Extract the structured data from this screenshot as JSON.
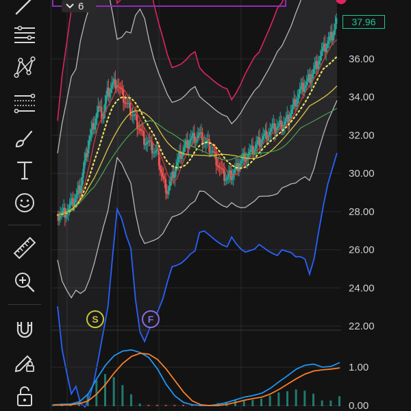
{
  "toolbar": {
    "tools": [
      {
        "name": "trend-line-tool-icon"
      },
      {
        "name": "horizontal-lines-tool-icon"
      },
      {
        "name": "pattern-tool-icon"
      },
      {
        "name": "fib-tool-icon"
      },
      {
        "name": "brush-tool-icon"
      },
      {
        "name": "text-tool-icon"
      },
      {
        "name": "emoji-tool-icon"
      },
      {
        "name": "ruler-tool-icon"
      },
      {
        "name": "zoom-in-tool-icon"
      },
      {
        "name": "magnet-tool-icon"
      },
      {
        "name": "lock-drawings-tool-icon"
      },
      {
        "name": "lock-tool-icon"
      }
    ]
  },
  "legend": {
    "collapsed_count": "6"
  },
  "price_tag": {
    "value": "37.96",
    "color": "#1ec79a"
  },
  "markers": [
    {
      "letter": "S",
      "color": "#c9c63a"
    },
    {
      "letter": "F",
      "color": "#8a6ce0"
    }
  ],
  "chart_data": [
    {
      "type": "candlestick",
      "ylim": [
        22.0,
        38.5
      ],
      "yticks": [
        "36.00",
        "34.00",
        "32.00",
        "30.00",
        "28.00",
        "26.00",
        "24.00",
        "22.00"
      ],
      "last_price": 37.96,
      "close_series": [
        27.8,
        27.9,
        28.0,
        28.3,
        28.7,
        29.2,
        30.5,
        31.8,
        32.6,
        33.4,
        33.0,
        34.2,
        34.6,
        34.8,
        34.2,
        33.7,
        33.3,
        32.9,
        32.4,
        31.8,
        31.6,
        31.2,
        31.0,
        29.8,
        29.1,
        29.6,
        30.4,
        31.0,
        31.4,
        31.8,
        31.9,
        32.0,
        31.7,
        31.5,
        31.1,
        30.6,
        30.0,
        29.7,
        29.9,
        30.2,
        30.6,
        30.9,
        31.0,
        31.3,
        31.6,
        31.9,
        32.1,
        32.3,
        32.4,
        32.5,
        32.7,
        33.2,
        33.8,
        34.3,
        34.6,
        34.9,
        35.4,
        35.9,
        36.4,
        36.8,
        37.2,
        37.96
      ],
      "indicators": [
        {
          "name": "bollinger-outer",
          "color": "#e0245e"
        },
        {
          "name": "bollinger-inner",
          "color": "#b9b9b9"
        },
        {
          "name": "lower-band",
          "color": "#2962ff"
        },
        {
          "name": "ma-fast",
          "color": "#e23a3a"
        },
        {
          "name": "ma-dotted",
          "color": "#f2e35a"
        },
        {
          "name": "ma-yellow",
          "color": "#d9c840"
        },
        {
          "name": "ma-slow",
          "color": "#4caf50"
        }
      ]
    },
    {
      "type": "line",
      "name": "oscillator",
      "ylim": [
        0.0,
        1.5
      ],
      "yticks": [
        "1.00",
        "0.00"
      ],
      "series": [
        {
          "color": "#2196f3",
          "values": [
            0.02,
            0.03,
            0.04,
            0.1,
            0.3,
            0.7,
            1.05,
            1.3,
            1.42,
            1.45,
            1.38,
            1.25,
            0.95,
            0.55,
            0.25,
            0.08,
            0.02,
            0.0,
            0.0,
            0.03,
            0.08,
            0.15,
            0.22,
            0.26,
            0.32,
            0.45,
            0.62,
            0.78,
            0.95,
            1.05,
            1.08,
            1.0,
            1.02,
            1.12
          ]
        },
        {
          "color": "#ff7f27",
          "values": [
            0.01,
            0.01,
            0.02,
            0.05,
            0.12,
            0.3,
            0.55,
            0.85,
            1.1,
            1.28,
            1.36,
            1.34,
            1.2,
            0.95,
            0.65,
            0.35,
            0.12,
            0.02,
            0.0,
            0.0,
            0.03,
            0.08,
            0.14,
            0.18,
            0.22,
            0.3,
            0.42,
            0.56,
            0.7,
            0.82,
            0.9,
            0.93,
            0.95,
            0.98
          ]
        }
      ]
    }
  ]
}
